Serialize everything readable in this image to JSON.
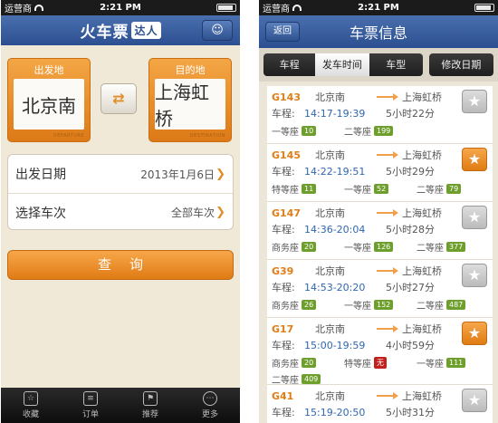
{
  "status": {
    "carrier": "运营商",
    "time": "2:21 PM"
  },
  "home": {
    "logo_text": "火车票",
    "logo_badge": "达人",
    "from_label": "出发地",
    "from_station": "北京南",
    "from_sub": "DEPARTURE",
    "to_label": "目的地",
    "to_station": "上海虹桥",
    "to_sub": "DESTINATION",
    "date_label": "出发日期",
    "date_value": "2013年1月6日",
    "train_label": "选择车次",
    "train_value": "全部车次",
    "query_label": "查询"
  },
  "tabs": [
    {
      "label": "收藏",
      "icon": "favorite-icon"
    },
    {
      "label": "订单",
      "icon": "order-icon"
    },
    {
      "label": "推荐",
      "icon": "recommend-icon"
    },
    {
      "label": "更多",
      "icon": "more-icon"
    }
  ],
  "results": {
    "title": "车票信息",
    "back_label": "返回",
    "sort": [
      "车程",
      "发车时间",
      "车型"
    ],
    "modify_date": "修改日期",
    "duration_key": "车程:",
    "trains": [
      {
        "code": "G143",
        "from": "北京南",
        "to": "上海虹桥",
        "time": "14:17-19:39",
        "duration": "5小时22分",
        "starred": false,
        "seats": [
          {
            "name": "一等座",
            "count": "10"
          },
          {
            "name": "二等座",
            "count": "199"
          }
        ]
      },
      {
        "code": "G145",
        "from": "北京南",
        "to": "上海虹桥",
        "time": "14:22-19:51",
        "duration": "5小时29分",
        "starred": true,
        "seats": [
          {
            "name": "特等座",
            "count": "11"
          },
          {
            "name": "一等座",
            "count": "52"
          },
          {
            "name": "二等座",
            "count": "79"
          }
        ]
      },
      {
        "code": "G147",
        "from": "北京南",
        "to": "上海虹桥",
        "time": "14:36-20:04",
        "duration": "5小时28分",
        "starred": false,
        "seats": [
          {
            "name": "商务座",
            "count": "20"
          },
          {
            "name": "一等座",
            "count": "126"
          },
          {
            "name": "二等座",
            "count": "377"
          }
        ]
      },
      {
        "code": "G39",
        "from": "北京南",
        "to": "上海虹桥",
        "time": "14:53-20:20",
        "duration": "5小时27分",
        "starred": false,
        "seats": [
          {
            "name": "商务座",
            "count": "26"
          },
          {
            "name": "一等座",
            "count": "152"
          },
          {
            "name": "二等座",
            "count": "487"
          }
        ]
      },
      {
        "code": "G17",
        "from": "北京南",
        "to": "上海虹桥",
        "time": "15:00-19:59",
        "duration": "4小时59分",
        "starred": true,
        "seats": [
          {
            "name": "商务座",
            "count": "20"
          },
          {
            "name": "特等座",
            "count": "无",
            "none": true
          },
          {
            "name": "一等座",
            "count": "111"
          },
          {
            "name": "二等座",
            "count": "409"
          }
        ]
      },
      {
        "code": "G41",
        "from": "北京南",
        "to": "上海虹桥",
        "time": "15:19-20:50",
        "duration": "5小时31分",
        "starred": false,
        "seats": []
      }
    ]
  }
}
